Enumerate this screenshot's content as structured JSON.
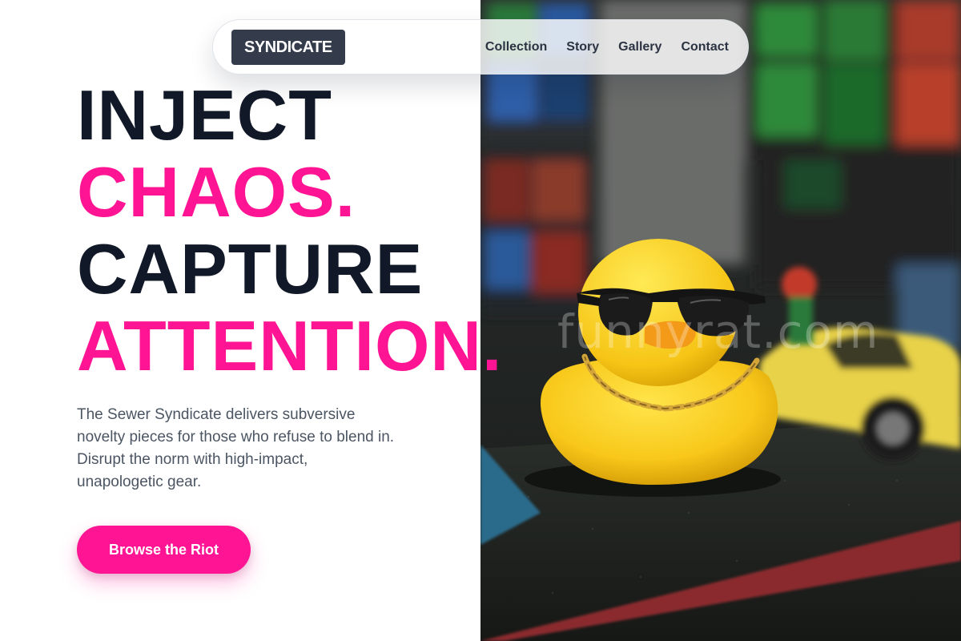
{
  "nav": {
    "brand": "SYNDICATE",
    "links": [
      "Collection",
      "Story",
      "Gallery",
      "Contact"
    ]
  },
  "hero": {
    "headline_lines": [
      {
        "text": "INJECT",
        "color": "#111827"
      },
      {
        "text": "CHAOS.",
        "color": "#ff1493"
      },
      {
        "text": "CAPTURE",
        "color": "#111827"
      },
      {
        "text": "ATTENTION.",
        "color": "#ff1493"
      }
    ],
    "description": "The Sewer Syndicate delivers subversive novelty pieces for those who refuse to blend in. Disrupt the norm with high-impact, unapologetic gear.",
    "cta_label": "Browse the Riot"
  },
  "image": {
    "subject": "yellow rubber duck wearing sunglasses and a gold chain beside a toy car",
    "watermark": "funnyrat.com"
  },
  "colors": {
    "accent": "#ff1493",
    "dark_text": "#111827",
    "body_text": "#4b5563",
    "brand_bg": "#343c4c"
  }
}
